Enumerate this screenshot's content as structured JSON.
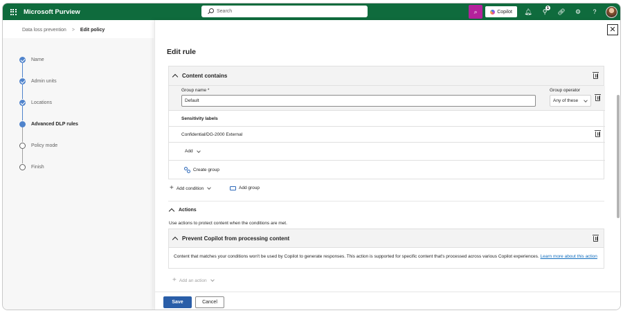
{
  "app": {
    "title": "Microsoft Purview"
  },
  "search": {
    "placeholder": "Search"
  },
  "topbar": {
    "copilot_label": "Copilot",
    "notification_count": "1",
    "help_label": "?"
  },
  "breadcrumb": {
    "parent": "Data loss prevention",
    "separator": ">",
    "current": "Edit policy"
  },
  "wizard": {
    "steps": [
      {
        "label": "Name",
        "state": "done"
      },
      {
        "label": "Admin units",
        "state": "done"
      },
      {
        "label": "Locations",
        "state": "done"
      },
      {
        "label": "Advanced DLP rules",
        "state": "current"
      },
      {
        "label": "Policy mode",
        "state": "pending"
      },
      {
        "label": "Finish",
        "state": "pending"
      }
    ]
  },
  "panel": {
    "title": "Edit rule",
    "content_contains": {
      "title": "Content contains",
      "group_name_label": "Group name *",
      "group_name_value": "Default",
      "group_operator_label": "Group operator",
      "group_operator_value": "Any of these",
      "sensitivity_labels_heading": "Sensitivity labels",
      "label_item": "Confidential/DG-2000 External",
      "add_label": "Add",
      "create_group_label": "Create group"
    },
    "add_condition_label": "Add condition",
    "add_group_label": "Add group",
    "actions": {
      "title": "Actions",
      "description": "Use actions to protect content when the conditions are met.",
      "action_title": "Prevent Copilot from processing content",
      "action_body": "Content that matches your conditions won't be used by Copilot to generate responses. This action is supported for specific content that's processed across various Copilot experiences.",
      "learn_more": "Learn more about this action",
      "add_action_label": "Add an action"
    },
    "footer": {
      "save_label": "Save",
      "cancel_label": "Cancel"
    }
  },
  "colors": {
    "topbar": "#0f6b3d",
    "accent": "#2a5ea8",
    "copilot_button": "#b4229c"
  }
}
